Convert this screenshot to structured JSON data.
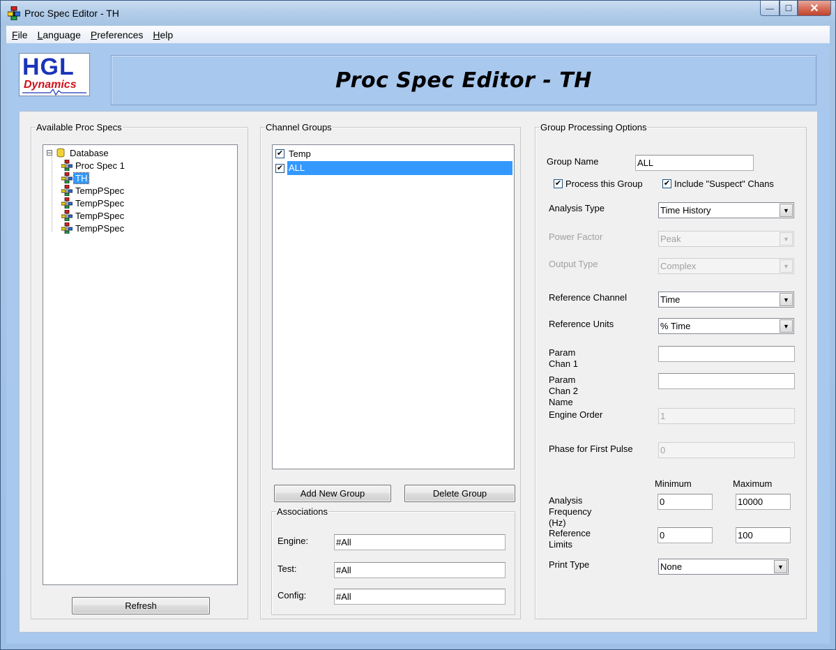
{
  "window": {
    "title": "Proc Spec Editor - TH",
    "minimize": "—",
    "maximize": "☐",
    "close": "✕"
  },
  "menu": {
    "file": {
      "mnemonic": "F",
      "rest": "ile"
    },
    "language": {
      "mnemonic": "L",
      "rest": "anguage"
    },
    "preferences": {
      "mnemonic": "P",
      "rest": "references"
    },
    "help": {
      "mnemonic": "H",
      "rest": "elp"
    }
  },
  "logo": {
    "line1": "HGL",
    "line2": "Dynamics"
  },
  "banner": {
    "title": "Proc Spec Editor - TH"
  },
  "available": {
    "legend": "Available Proc Specs",
    "root": {
      "expander": "⊟",
      "label": "Database"
    },
    "items": [
      {
        "label": "Proc Spec 1",
        "selected": false
      },
      {
        "label": "TH",
        "selected": true
      },
      {
        "label": "TempPSpec",
        "selected": false
      },
      {
        "label": "TempPSpec",
        "selected": false
      },
      {
        "label": "TempPSpec",
        "selected": false
      },
      {
        "label": "TempPSpec",
        "selected": false
      }
    ],
    "refresh_label": "Refresh"
  },
  "channel_groups": {
    "legend": "Channel Groups",
    "items": [
      {
        "label": "Temp",
        "checked": true,
        "selected": false
      },
      {
        "label": "ALL",
        "checked": true,
        "selected": true
      }
    ],
    "add_label": "Add New Group",
    "delete_label": "Delete Group"
  },
  "associations": {
    "legend": "Associations",
    "engine_label": "Engine:",
    "engine_value": "#All",
    "test_label": "Test:",
    "test_value": "#All",
    "config_label": "Config:",
    "config_value": "#All"
  },
  "options": {
    "legend": "Group Processing Options",
    "group_name_label": "Group Name",
    "group_name_value": "ALL",
    "process_label": "Process this Group",
    "process_checked": true,
    "suspect_label": "Include \"Suspect\" Chans",
    "suspect_checked": true,
    "analysis_type_label": "Analysis Type",
    "analysis_type_value": "Time History",
    "power_factor_label": "Power Factor",
    "power_factor_value": "Peak",
    "output_type_label": "Output Type",
    "output_type_value": "Complex",
    "ref_channel_label": "Reference Channel",
    "ref_channel_value": "Time",
    "ref_units_label": "Reference Units",
    "ref_units_value": "% Time",
    "param1_label": "Param\nChan 1\nName",
    "param1_value": "",
    "param2_label": "Param\nChan 2\nName",
    "param2_value": "",
    "engine_order_label": "Engine Order",
    "engine_order_value": "1",
    "phase_label": "Phase for First Pulse",
    "phase_value": "0",
    "minimum_label": "Minimum",
    "maximum_label": "Maximum",
    "analysis_freq_label": "Analysis\nFrequency\n(Hz)",
    "freq_min": "0",
    "freq_max": "10000",
    "ref_limits_label": "Reference\nLimits",
    "ref_min": "0",
    "ref_max": "100",
    "print_type_label": "Print Type",
    "print_type_value": "None"
  },
  "icons": {
    "combo_arrow": "▼",
    "check": "✔"
  }
}
